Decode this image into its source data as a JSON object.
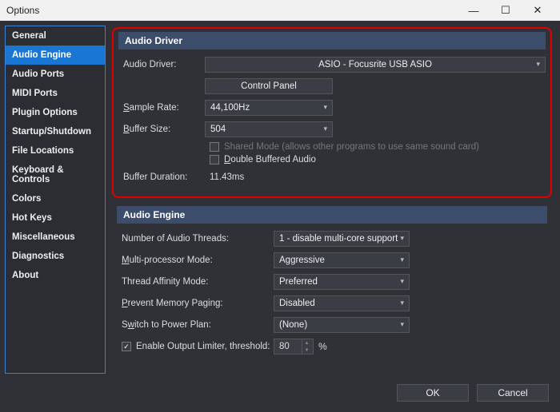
{
  "window": {
    "title": "Options"
  },
  "sidebar": {
    "items": [
      {
        "label": "General"
      },
      {
        "label": "Audio Engine"
      },
      {
        "label": "Audio Ports"
      },
      {
        "label": "MIDI Ports"
      },
      {
        "label": "Plugin Options"
      },
      {
        "label": "Startup/Shutdown"
      },
      {
        "label": "File Locations"
      },
      {
        "label": "Keyboard & Controls"
      },
      {
        "label": "Colors"
      },
      {
        "label": "Hot Keys"
      },
      {
        "label": "Miscellaneous"
      },
      {
        "label": "Diagnostics"
      },
      {
        "label": "About"
      }
    ]
  },
  "driver": {
    "section_title": "Audio Driver",
    "driver_label": "Audio Driver:",
    "driver_value": "ASIO - Focusrite USB ASIO",
    "control_panel": "Control Panel",
    "sample_rate_label": "Sample Rate:",
    "sample_rate_value": "44,100Hz",
    "buffer_size_label": "Buffer Size:",
    "buffer_size_value": "504",
    "shared_mode_label": "Shared Mode (allows other programs to use same sound card)",
    "double_buffered_label": "Double Buffered Audio",
    "buffer_duration_label": "Buffer Duration:",
    "buffer_duration_value": "11.43ms"
  },
  "engine": {
    "section_title": "Audio Engine",
    "threads_label": "Number of Audio Threads:",
    "threads_value": "1 - disable multi-core support",
    "mp_label": "Multi-processor Mode:",
    "mp_value": "Aggressive",
    "affinity_label": "Thread Affinity Mode:",
    "affinity_value": "Preferred",
    "paging_label": "Prevent Memory Paging:",
    "paging_value": "Disabled",
    "power_label": "Switch to Power Plan:",
    "power_value": "(None)",
    "limiter_label": "Enable Output Limiter, threshold:",
    "limiter_value": "80",
    "limiter_unit": "%"
  },
  "footer": {
    "ok": "OK",
    "cancel": "Cancel"
  }
}
